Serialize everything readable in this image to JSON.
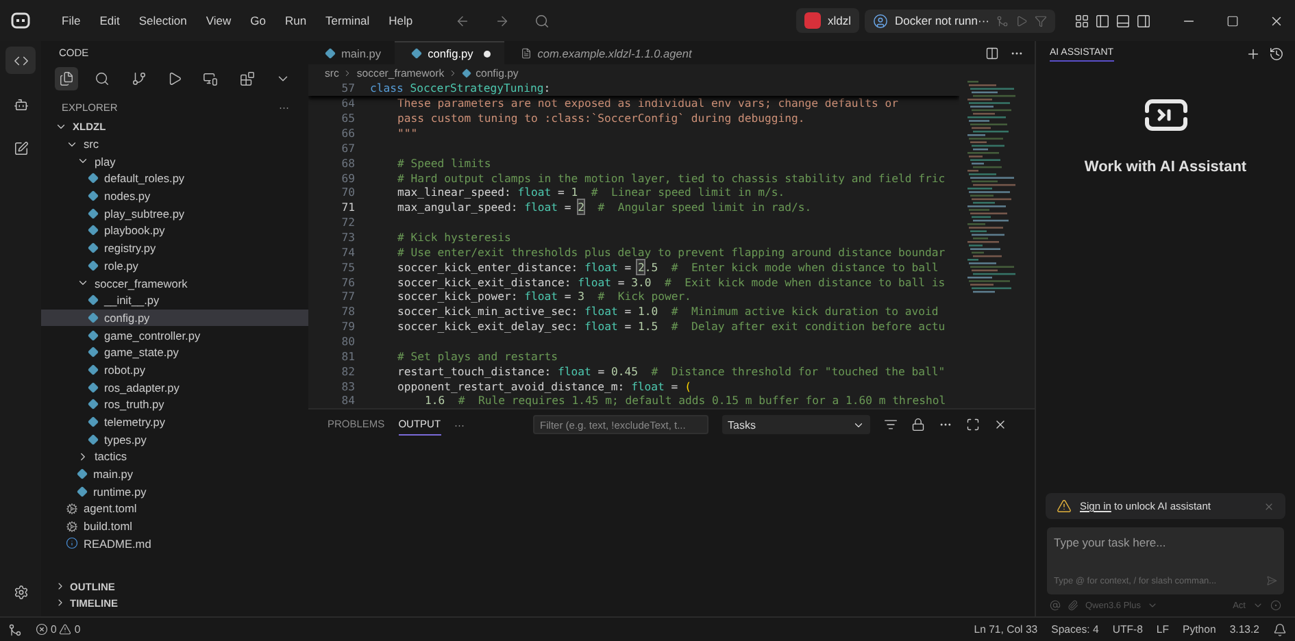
{
  "menu": [
    "File",
    "Edit",
    "Selection",
    "View",
    "Go",
    "Run",
    "Terminal",
    "Help"
  ],
  "account": {
    "name": "xldzl"
  },
  "docker": {
    "label": "Docker not runn···"
  },
  "sidebar": {
    "title": "CODE",
    "section": "EXPLORER",
    "more": "···",
    "tree": [
      {
        "label": "XLDZL",
        "kind": "root",
        "expanded": true,
        "selected": false,
        "children": [
          {
            "label": "src",
            "kind": "folder",
            "expanded": true,
            "selected": false,
            "children": [
              {
                "label": "play",
                "kind": "folder",
                "expanded": true,
                "selected": false,
                "children": [
                  {
                    "label": "default_roles.py",
                    "kind": "python",
                    "selected": false
                  },
                  {
                    "label": "nodes.py",
                    "kind": "python",
                    "selected": false
                  },
                  {
                    "label": "play_subtree.py",
                    "kind": "python",
                    "selected": false
                  },
                  {
                    "label": "playbook.py",
                    "kind": "python",
                    "selected": false
                  },
                  {
                    "label": "registry.py",
                    "kind": "python",
                    "selected": false
                  },
                  {
                    "label": "role.py",
                    "kind": "python",
                    "selected": false
                  }
                ]
              },
              {
                "label": "soccer_framework",
                "kind": "folder",
                "expanded": true,
                "selected": false,
                "children": [
                  {
                    "label": "__init__.py",
                    "kind": "python",
                    "selected": false
                  },
                  {
                    "label": "config.py",
                    "kind": "python",
                    "selected": true
                  },
                  {
                    "label": "game_controller.py",
                    "kind": "python",
                    "selected": false
                  },
                  {
                    "label": "game_state.py",
                    "kind": "python",
                    "selected": false
                  },
                  {
                    "label": "robot.py",
                    "kind": "python",
                    "selected": false
                  },
                  {
                    "label": "ros_adapter.py",
                    "kind": "python",
                    "selected": false
                  },
                  {
                    "label": "ros_truth.py",
                    "kind": "python",
                    "selected": false
                  },
                  {
                    "label": "telemetry.py",
                    "kind": "python",
                    "selected": false
                  },
                  {
                    "label": "types.py",
                    "kind": "python",
                    "selected": false
                  }
                ]
              },
              {
                "label": "tactics",
                "kind": "folder",
                "expanded": false,
                "selected": false
              },
              {
                "label": "main.py",
                "kind": "python",
                "selected": false
              },
              {
                "label": "runtime.py",
                "kind": "python",
                "selected": false
              }
            ]
          },
          {
            "label": "agent.toml",
            "kind": "config",
            "selected": false
          },
          {
            "label": "build.toml",
            "kind": "config",
            "selected": false
          },
          {
            "label": "README.md",
            "kind": "info",
            "selected": false
          }
        ]
      }
    ],
    "sections": [
      {
        "label": "OUTLINE",
        "expanded": false
      },
      {
        "label": "TIMELINE",
        "expanded": false
      }
    ]
  },
  "tabs": [
    {
      "label": "main.py",
      "kind": "python",
      "selected": false,
      "modified": false
    },
    {
      "label": "config.py",
      "kind": "python",
      "selected": true,
      "modified": true
    },
    {
      "label": "com.example.xldzl-1.1.0.agent",
      "kind": "preview",
      "selected": false,
      "modified": false
    }
  ],
  "breadcrumbs": [
    "src",
    "soccer_framework",
    "config.py"
  ],
  "code": [
    {
      "number": "57",
      "kind": "sticky",
      "current": false,
      "tokens": [
        {
          "kind": "kw",
          "text": "class "
        },
        {
          "kind": "cls",
          "text": "SoccerStrategyTuning"
        },
        {
          "kind": "plain",
          "text": ":"
        }
      ]
    },
    {
      "number": "64",
      "kind": "body",
      "current": false,
      "tokens": [
        {
          "kind": "str",
          "text": "These parameters are not exposed as individual env vars; change defaults or"
        }
      ]
    },
    {
      "number": "65",
      "kind": "body",
      "current": false,
      "tokens": [
        {
          "kind": "str",
          "text": "pass custom tuning to :class:`SoccerConfig` during debugging."
        }
      ]
    },
    {
      "number": "66",
      "kind": "body",
      "current": false,
      "tokens": [
        {
          "kind": "str",
          "text": "\"\"\""
        }
      ]
    },
    {
      "number": "67",
      "kind": "body",
      "current": false
    },
    {
      "number": "68",
      "kind": "body",
      "current": false,
      "tokens": [
        {
          "kind": "com",
          "text": "# Speed limits"
        }
      ]
    },
    {
      "number": "69",
      "kind": "body",
      "current": false,
      "tokens": [
        {
          "kind": "com",
          "text": "# Hard output clamps in the motion layer, tied to chassis stability and field fric"
        }
      ]
    },
    {
      "number": "70",
      "kind": "body",
      "current": false,
      "tokens": [
        {
          "kind": "plain",
          "text": "max_linear_speed: "
        },
        {
          "kind": "typ",
          "text": "float"
        },
        {
          "kind": "plain",
          "text": " = "
        },
        {
          "kind": "num",
          "text": "1"
        },
        {
          "kind": "com",
          "text": "  #  Linear speed limit in m/s."
        }
      ]
    },
    {
      "number": "71",
      "kind": "body",
      "current": true,
      "tokens": [
        {
          "kind": "plain",
          "text": "max_angular_speed: "
        },
        {
          "kind": "typ",
          "text": "float"
        },
        {
          "kind": "plain",
          "text": " = "
        },
        {
          "kind": "boxed",
          "text": "2"
        },
        {
          "kind": "com",
          "text": "  #  Angular speed limit in rad/s."
        }
      ]
    },
    {
      "number": "72",
      "kind": "body",
      "current": false
    },
    {
      "number": "73",
      "kind": "body",
      "current": false,
      "tokens": [
        {
          "kind": "com",
          "text": "# Kick hysteresis"
        }
      ]
    },
    {
      "number": "74",
      "kind": "body",
      "current": false,
      "tokens": [
        {
          "kind": "com",
          "text": "# Use enter/exit thresholds plus delay to prevent flapping around distance boundar"
        }
      ]
    },
    {
      "number": "75",
      "kind": "body",
      "current": false,
      "tokens": [
        {
          "kind": "plain",
          "text": "soccer_kick_enter_distance: "
        },
        {
          "kind": "typ",
          "text": "float"
        },
        {
          "kind": "plain",
          "text": " = "
        },
        {
          "kind": "boxed",
          "text": "2"
        },
        {
          "kind": "num",
          "text": ".5"
        },
        {
          "kind": "com",
          "text": "  #  Enter kick mode when distance to ball"
        }
      ]
    },
    {
      "number": "76",
      "kind": "body",
      "current": false,
      "tokens": [
        {
          "kind": "plain",
          "text": "soccer_kick_exit_distance: "
        },
        {
          "kind": "typ",
          "text": "float"
        },
        {
          "kind": "plain",
          "text": " = "
        },
        {
          "kind": "num",
          "text": "3.0"
        },
        {
          "kind": "com",
          "text": "  #  Exit kick mode when distance to ball is"
        }
      ]
    },
    {
      "number": "77",
      "kind": "body",
      "current": false,
      "tokens": [
        {
          "kind": "plain",
          "text": "soccer_kick_power: "
        },
        {
          "kind": "typ",
          "text": "float"
        },
        {
          "kind": "plain",
          "text": " = "
        },
        {
          "kind": "num",
          "text": "3"
        },
        {
          "kind": "com",
          "text": "  #  Kick power."
        }
      ]
    },
    {
      "number": "78",
      "kind": "body",
      "current": false,
      "tokens": [
        {
          "kind": "plain",
          "text": "soccer_kick_min_active_sec: "
        },
        {
          "kind": "typ",
          "text": "float"
        },
        {
          "kind": "plain",
          "text": " = "
        },
        {
          "kind": "num",
          "text": "1.0"
        },
        {
          "kind": "com",
          "text": "  #  Minimum active kick duration to avoid"
        }
      ]
    },
    {
      "number": "79",
      "kind": "body",
      "current": false,
      "tokens": [
        {
          "kind": "plain",
          "text": "soccer_kick_exit_delay_sec: "
        },
        {
          "kind": "typ",
          "text": "float"
        },
        {
          "kind": "plain",
          "text": " = "
        },
        {
          "kind": "num",
          "text": "1.5"
        },
        {
          "kind": "com",
          "text": "  #  Delay after exit condition before actu"
        }
      ]
    },
    {
      "number": "80",
      "kind": "body",
      "current": false
    },
    {
      "number": "81",
      "kind": "body",
      "current": false,
      "tokens": [
        {
          "kind": "com",
          "text": "# Set plays and restarts"
        }
      ]
    },
    {
      "number": "82",
      "kind": "body",
      "current": false,
      "tokens": [
        {
          "kind": "plain",
          "text": "restart_touch_distance: "
        },
        {
          "kind": "typ",
          "text": "float"
        },
        {
          "kind": "plain",
          "text": " = "
        },
        {
          "kind": "num",
          "text": "0.45"
        },
        {
          "kind": "com",
          "text": "  #  Distance threshold for \"touched the ball\""
        }
      ]
    },
    {
      "number": "83",
      "kind": "body",
      "current": false,
      "tokens": [
        {
          "kind": "plain",
          "text": "opponent_restart_avoid_distance_m: "
        },
        {
          "kind": "typ",
          "text": "float"
        },
        {
          "kind": "plain",
          "text": " = "
        },
        {
          "kind": "paren",
          "text": "("
        }
      ]
    },
    {
      "number": "84",
      "kind": "cont",
      "current": false,
      "tokens": [
        {
          "kind": "num",
          "text": "1.6"
        },
        {
          "kind": "com",
          "text": "  #  Rule requires 1.45 m; default adds 0.15 m buffer for a 1.60 m threshol"
        }
      ]
    }
  ],
  "panel": {
    "tabs": [
      {
        "label": "PROBLEMS",
        "selected": false
      },
      {
        "label": "OUTPUT",
        "selected": true
      }
    ],
    "more": "···",
    "filter": {
      "placeholder": "Filter (e.g. text, !excludeText, t..."
    },
    "select": "Tasks"
  },
  "assistant": {
    "tab": "AI ASSISTANT",
    "heading": "Work with AI Assistant",
    "notice": {
      "link": "Sign in",
      "text": " to unlock AI assistant"
    },
    "input": {
      "placeholder": "Type your task here...",
      "hint": "Type @ for context, / for slash comman..."
    },
    "model": "Qwen3.6 Plus",
    "mode": "Act"
  },
  "status": {
    "errors": "0",
    "warnings": "0",
    "items": [
      "Ln 71, Col 33",
      "Spaces: 4",
      "UTF-8",
      "LF",
      "Python",
      "3.13.2"
    ]
  }
}
